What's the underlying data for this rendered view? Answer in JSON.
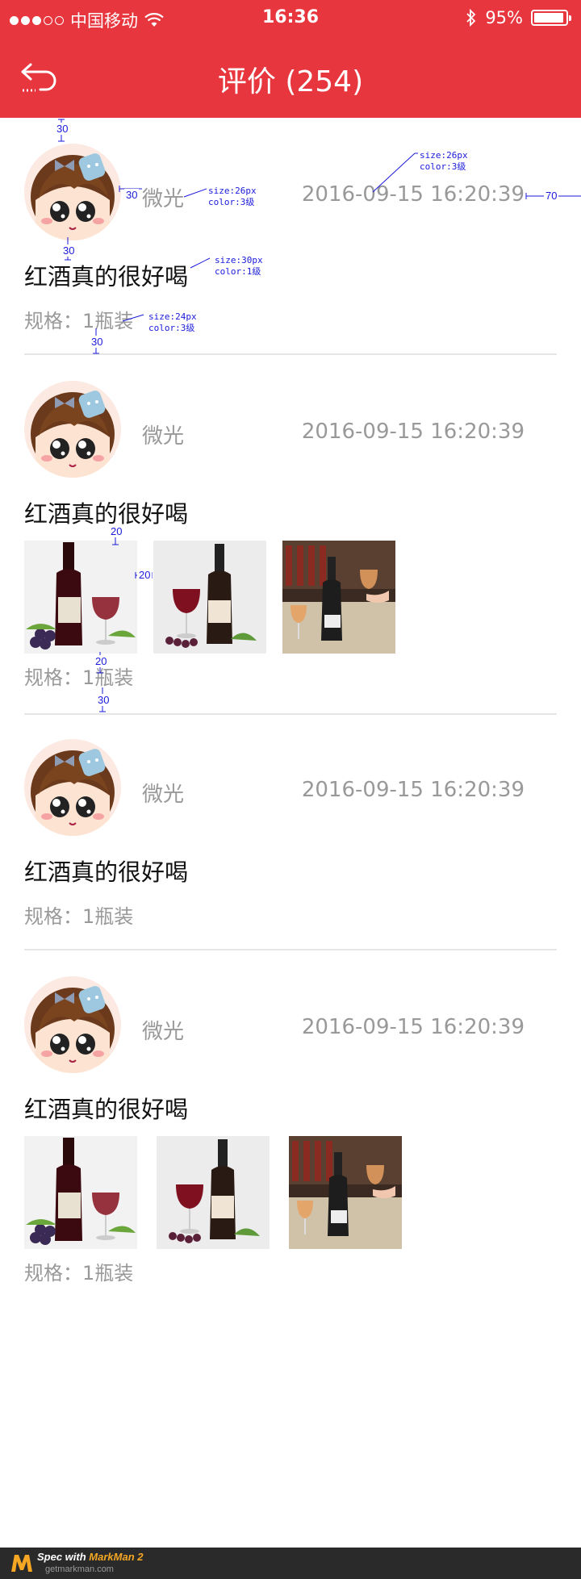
{
  "status_bar": {
    "carrier": "中国移动",
    "time": "16:36",
    "battery_text": "95%",
    "battery_level": 0.95
  },
  "header": {
    "title": "评价 (254)",
    "back_icon": "back-arrow-icon",
    "background": "#e8363e"
  },
  "reviews": [
    {
      "user": "微光",
      "time": "2016-09-15 16:20:39",
      "content": "红酒真的很好喝",
      "spec": "规格：1瓶装",
      "photos": []
    },
    {
      "user": "微光",
      "time": "2016-09-15 16:20:39",
      "content": "红酒真的很好喝",
      "spec": "规格：1瓶装",
      "photos": [
        "wine-bottle-grapes",
        "wine-bottle-glass",
        "wine-shelf-pour"
      ]
    },
    {
      "user": "微光",
      "time": "2016-09-15 16:20:39",
      "content": "红酒真的很好喝",
      "spec": "规格：1瓶装",
      "photos": []
    },
    {
      "user": "微光",
      "time": "2016-09-15 16:20:39",
      "content": "红酒真的很好喝",
      "spec": "规格：1瓶装",
      "photos": [
        "wine-bottle-grapes",
        "wine-bottle-glass",
        "wine-shelf-pour"
      ]
    }
  ],
  "annotations": {
    "n30a": "30",
    "n30b": "30",
    "n30c": "30",
    "n30d": "30",
    "n70": "70",
    "n20a": "20",
    "n20b": "20",
    "n20c": "20",
    "n30e": "30",
    "name_spec": "size:26px\ncolor:3级",
    "time_spec": "size:26px\ncolor:3级",
    "content_spec": "size:30px\ncolor:1级",
    "spec_spec": "size:24px\ncolor:3级"
  },
  "footer": {
    "prefix": "Spec with ",
    "brand": "MarkMan 2",
    "url": "getmarkman.com"
  }
}
